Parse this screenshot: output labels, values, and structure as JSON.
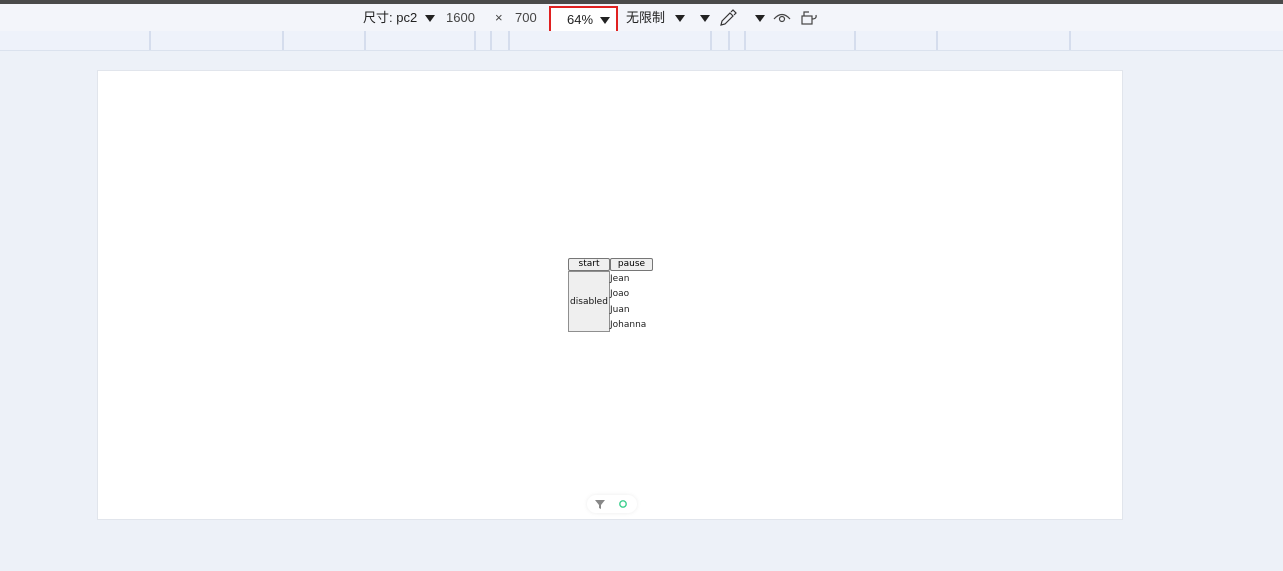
{
  "toolbar": {
    "size_label": "尺寸: pc2",
    "width_value": "1600",
    "times_symbol": "×",
    "height_value": "700",
    "zoom_value": "64%",
    "throttle_label": "无限制"
  },
  "page": {
    "start_button": "start",
    "pause_button": "pause",
    "disabled_label": "disabled",
    "names": [
      "Jean",
      "Joao",
      "Juan",
      "Johanna"
    ]
  },
  "colors": {
    "highlight_border": "#e02020",
    "background": "#edf1f8",
    "canvas": "#ffffff",
    "status_dot": "#3ccf8e"
  }
}
